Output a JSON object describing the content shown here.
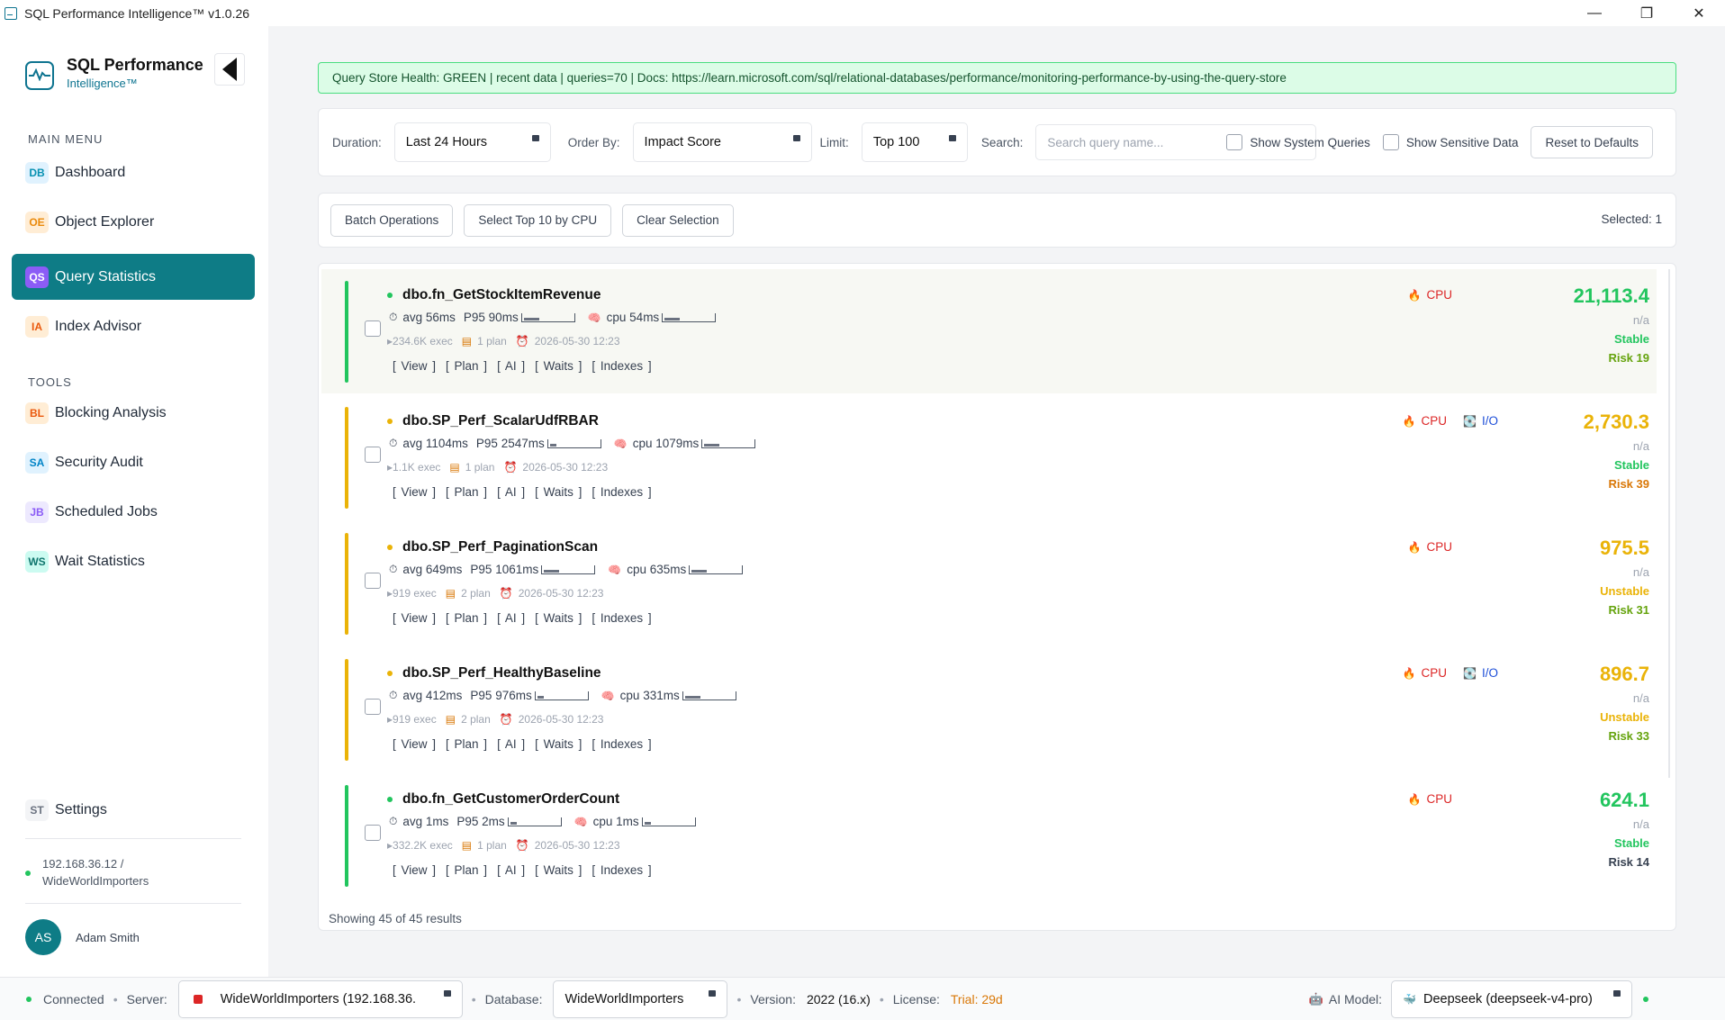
{
  "window": {
    "title": "SQL Performance Intelligence™ v1.0.26",
    "minimize": "—",
    "maximize": "❐",
    "close": "✕"
  },
  "sidebar": {
    "brand_title": "SQL Performance",
    "brand_sub": "Intelligence™",
    "main_menu_label": "MAIN MENU",
    "tools_label": "TOOLS",
    "main_items": [
      {
        "badge": "DB",
        "label": "Dashboard"
      },
      {
        "badge": "OE",
        "label": "Object Explorer"
      },
      {
        "badge": "QS",
        "label": "Query Statistics"
      },
      {
        "badge": "IA",
        "label": "Index Advisor"
      }
    ],
    "tool_items": [
      {
        "badge": "BL",
        "label": "Blocking Analysis"
      },
      {
        "badge": "SA",
        "label": "Security Audit"
      },
      {
        "badge": "JB",
        "label": "Scheduled Jobs"
      },
      {
        "badge": "WS",
        "label": "Wait Statistics"
      }
    ],
    "settings": {
      "badge": "ST",
      "label": "Settings"
    },
    "connection_line1": "192.168.36.12 /",
    "connection_line2": "WideWorldImporters",
    "user_initials": "AS",
    "user_name": "Adam Smith"
  },
  "health_banner": "Query Store Health: GREEN | recent data | queries=70 | Docs: https://learn.microsoft.com/sql/relational-databases/performance/monitoring-performance-by-using-the-query-store",
  "filters": {
    "duration_label": "Duration:",
    "duration_value": "Last 24 Hours",
    "order_label": "Order By:",
    "order_value": "Impact Score",
    "limit_label": "Limit:",
    "limit_value": "Top 100",
    "search_label": "Search:",
    "search_placeholder": "Search query name...",
    "show_system": "Show System Queries",
    "show_sensitive": "Show Sensitive Data",
    "reset": "Reset to Defaults"
  },
  "batch": {
    "batch_ops": "Batch Operations",
    "select_top": "Select Top 10 by CPU",
    "clear": "Clear Selection",
    "selected": "Selected: 1"
  },
  "queries": [
    {
      "name": "dbo.fn_GetStockItemRevenue",
      "status": "green",
      "avg": "avg 56ms",
      "p95": "P95 90ms",
      "p95_fill": 0.3,
      "cpu": "cpu 54ms",
      "cpu_fill": 0.3,
      "exec": "234.6K exec",
      "plans": "1 plan",
      "time": "2026-05-30 12:23",
      "tags": [
        "CPU"
      ],
      "score": "21,113.4",
      "score_color": "#22c55e",
      "na": "n/a",
      "stability": "Stable",
      "stability_color": "#22c55e",
      "risk": "Risk 19",
      "risk_color": "#65a30d"
    },
    {
      "name": "dbo.SP_Perf_ScalarUdfRBAR",
      "status": "amber",
      "avg": "avg 1104ms",
      "p95": "P95 2547ms",
      "p95_fill": 0.12,
      "cpu": "cpu 1079ms",
      "cpu_fill": 0.3,
      "exec": "1.1K exec",
      "plans": "1 plan",
      "time": "2026-05-30 12:23",
      "tags": [
        "CPU",
        "I/O"
      ],
      "score": "2,730.3",
      "score_color": "#eab308",
      "na": "n/a",
      "stability": "Stable",
      "stability_color": "#22c55e",
      "risk": "Risk 39",
      "risk_color": "#d97706"
    },
    {
      "name": "dbo.SP_Perf_PaginationScan",
      "status": "amber",
      "avg": "avg 649ms",
      "p95": "P95 1061ms",
      "p95_fill": 0.3,
      "cpu": "cpu 635ms",
      "cpu_fill": 0.3,
      "exec": "919 exec",
      "plans": "2 plan",
      "time": "2026-05-30 12:23",
      "tags": [
        "CPU"
      ],
      "score": "975.5",
      "score_color": "#eab308",
      "na": "n/a",
      "stability": "Unstable",
      "stability_color": "#eab308",
      "risk": "Risk 31",
      "risk_color": "#65a30d"
    },
    {
      "name": "dbo.SP_Perf_HealthyBaseline",
      "status": "amber",
      "avg": "avg 412ms",
      "p95": "P95 976ms",
      "p95_fill": 0.12,
      "cpu": "cpu 331ms",
      "cpu_fill": 0.3,
      "exec": "919 exec",
      "plans": "2 plan",
      "time": "2026-05-30 12:23",
      "tags": [
        "CPU",
        "I/O"
      ],
      "score": "896.7",
      "score_color": "#eab308",
      "na": "n/a",
      "stability": "Unstable",
      "stability_color": "#eab308",
      "risk": "Risk 33",
      "risk_color": "#65a30d"
    },
    {
      "name": "dbo.fn_GetCustomerOrderCount",
      "status": "green",
      "avg": "avg 1ms",
      "p95": "P95 2ms",
      "p95_fill": 0.12,
      "cpu": "cpu 1ms",
      "cpu_fill": 0.12,
      "exec": "332.2K exec",
      "plans": "1 plan",
      "time": "2026-05-30 12:23",
      "tags": [
        "CPU"
      ],
      "score": "624.1",
      "score_color": "#22c55e",
      "na": "n/a",
      "stability": "Stable",
      "stability_color": "#22c55e",
      "risk": "Risk 14",
      "risk_color": "#374151"
    }
  ],
  "row_links": [
    "[ View ]",
    "[ Plan ]",
    "[ AI ]",
    "[ Waits ]",
    "[ Indexes ]"
  ],
  "results_footer": "Showing 45 of 45 results",
  "statusbar": {
    "connected": "Connected",
    "server_label": "Server:",
    "server_value": "WideWorldImporters (192.168.36.",
    "database_label": "Database:",
    "database_value": "WideWorldImporters",
    "version_label": "Version:",
    "version_value": "2022 (16.x)",
    "license_label": "License:",
    "license_value": "Trial: 29d",
    "ai_label": "AI Model:",
    "ai_value": "Deepseek (deepseek-v4-pro)"
  },
  "colors": {
    "accent": "#0e7c86",
    "health_bg": "#dcfce7",
    "status_green": "#22c55e",
    "status_amber": "#eab308",
    "tag_cpu": "#dc2626",
    "tag_io": "#1d4ed8",
    "trial": "#d97706"
  }
}
